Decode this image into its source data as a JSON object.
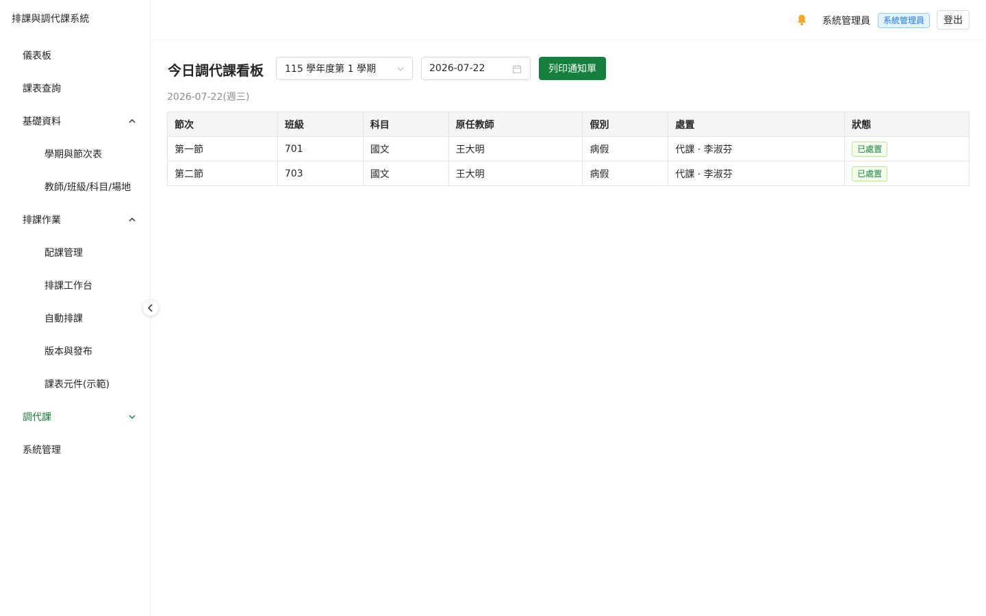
{
  "app": {
    "title": "排課與調代課系統"
  },
  "sidebar": {
    "items": [
      {
        "label": "儀表板",
        "level": 1
      },
      {
        "label": "課表查詢",
        "level": 1
      },
      {
        "label": "基礎資料",
        "level": 1,
        "expanded": true
      },
      {
        "label": "學期與節次表",
        "level": 2
      },
      {
        "label": "教師/班級/科目/場地",
        "level": 2
      },
      {
        "label": "排課作業",
        "level": 1,
        "expanded": true
      },
      {
        "label": "配課管理",
        "level": 2
      },
      {
        "label": "排課工作台",
        "level": 2
      },
      {
        "label": "自動排課",
        "level": 2
      },
      {
        "label": "版本與發布",
        "level": 2
      },
      {
        "label": "課表元件(示範)",
        "level": 2
      },
      {
        "label": "調代課",
        "level": 1,
        "expanded": false,
        "active": true
      },
      {
        "label": "系統管理",
        "level": 1
      }
    ]
  },
  "header": {
    "user_name": "系統管理員",
    "role": "系統管理員",
    "logout_label": "登出"
  },
  "main": {
    "title": "今日調代課看板",
    "term_select": "115 學年度第 1 學期",
    "date_value": "2026-07-22",
    "print_label": "列印通知單",
    "date_subtitle": "2026-07-22(週三)",
    "table": {
      "columns": [
        "節次",
        "班級",
        "科目",
        "原任教師",
        "假別",
        "處置",
        "狀態"
      ],
      "rows": [
        [
          "第一節",
          "701",
          "國文",
          "王大明",
          "病假",
          "代課 · 李淑芬",
          "已處置"
        ],
        [
          "第二節",
          "703",
          "國文",
          "王大明",
          "病假",
          "代課 · 李淑芬",
          "已處置"
        ]
      ]
    }
  },
  "colors": {
    "accent": "#15803d",
    "role_tag": "#1677ff",
    "bell": "#f5a623"
  }
}
